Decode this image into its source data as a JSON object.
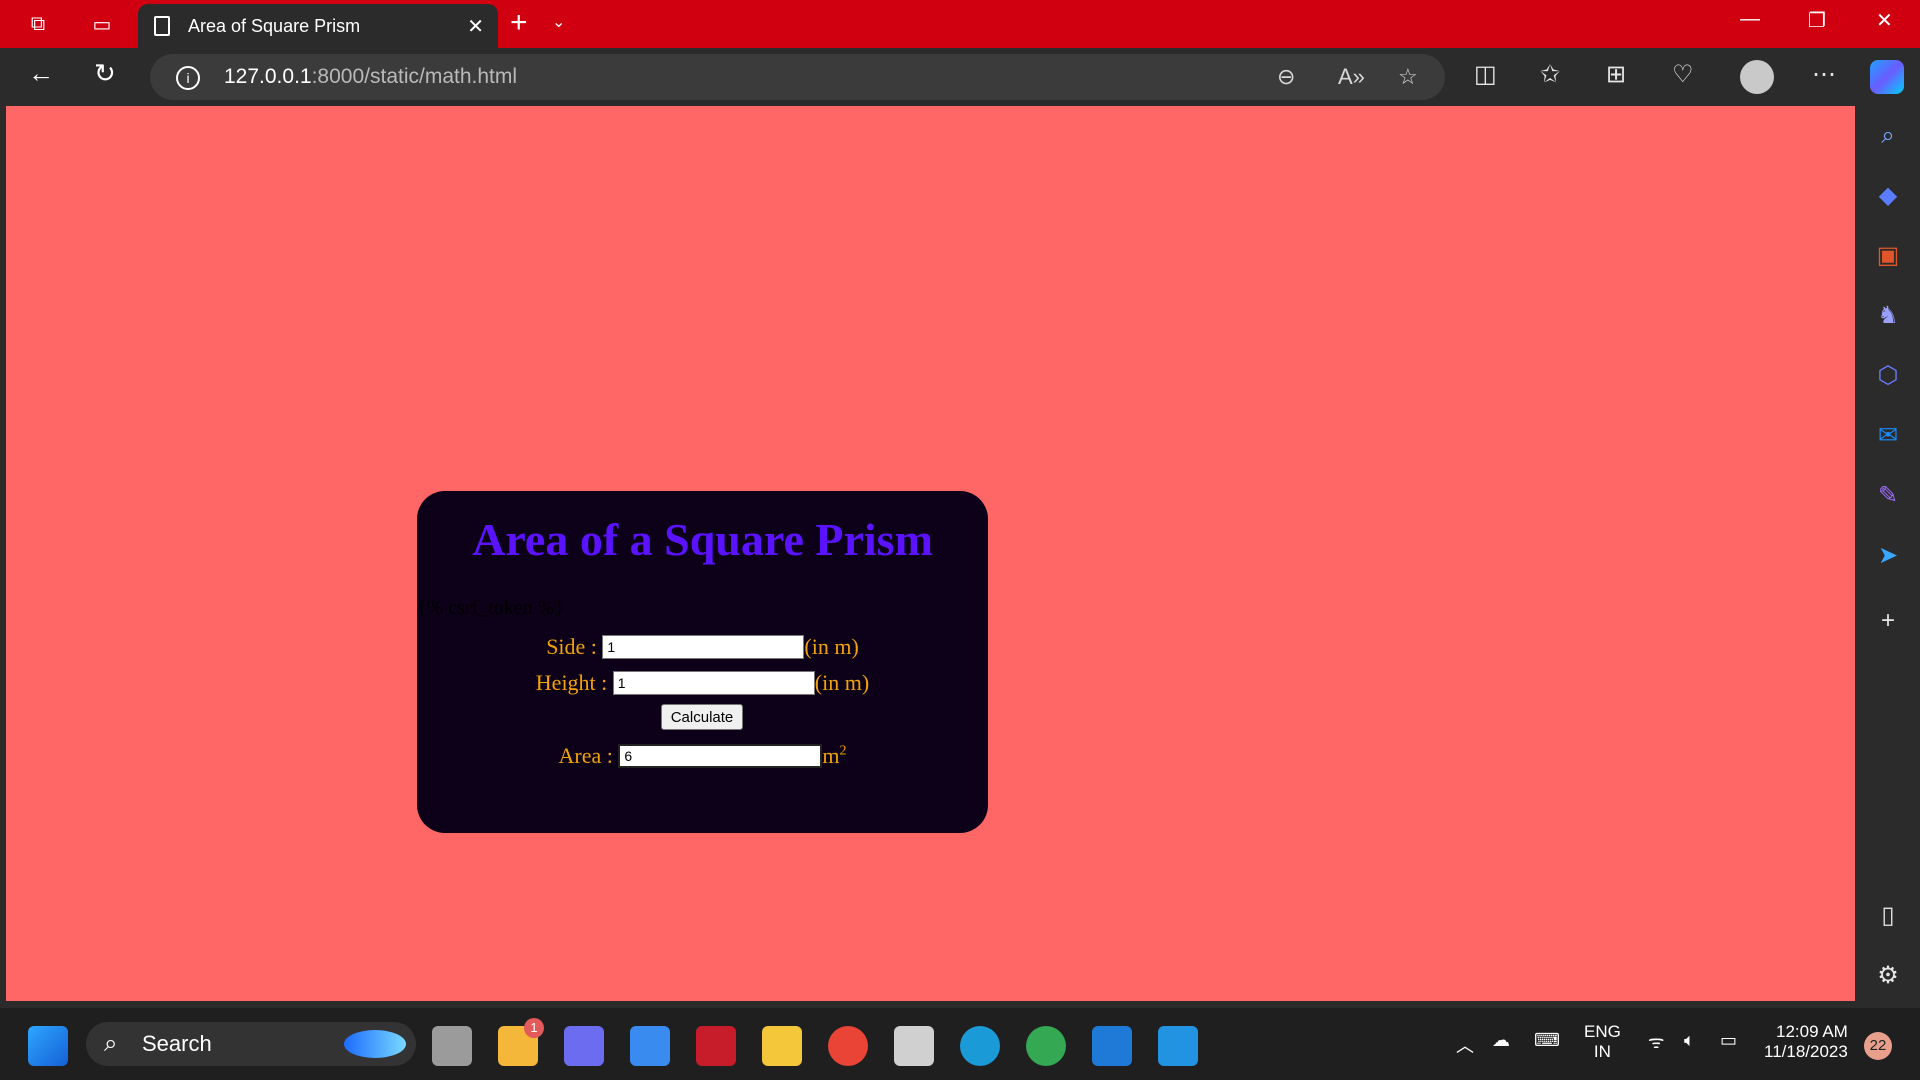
{
  "browser": {
    "tab_title": "Area of Square Prism",
    "url_host": "127.0.0.1",
    "url_rest": ":8000/static/math.html"
  },
  "page": {
    "heading": "Area of a Square Prism",
    "csrf_text": "{% csrf_token %}",
    "side_label": "Side :",
    "side_value": "1",
    "side_unit": "(in m)",
    "height_label": "Height :",
    "height_value": "1",
    "height_unit": "(in m)",
    "calculate_label": "Calculate",
    "area_label": "Area :",
    "area_value": "6",
    "area_unit": "m",
    "area_unit_sup": "2"
  },
  "taskbar": {
    "search_label": "Search",
    "weather_badge": "1",
    "lang_top": "ENG",
    "lang_bottom": "IN",
    "time": "12:09 AM",
    "date": "11/18/2023",
    "notification_count": "22"
  },
  "colors": {
    "page_bg": "#ff6666",
    "card_bg": "#0c0118",
    "heading": "#5a12ff",
    "label": "#f2a20a",
    "titlebar": "#d10010"
  }
}
